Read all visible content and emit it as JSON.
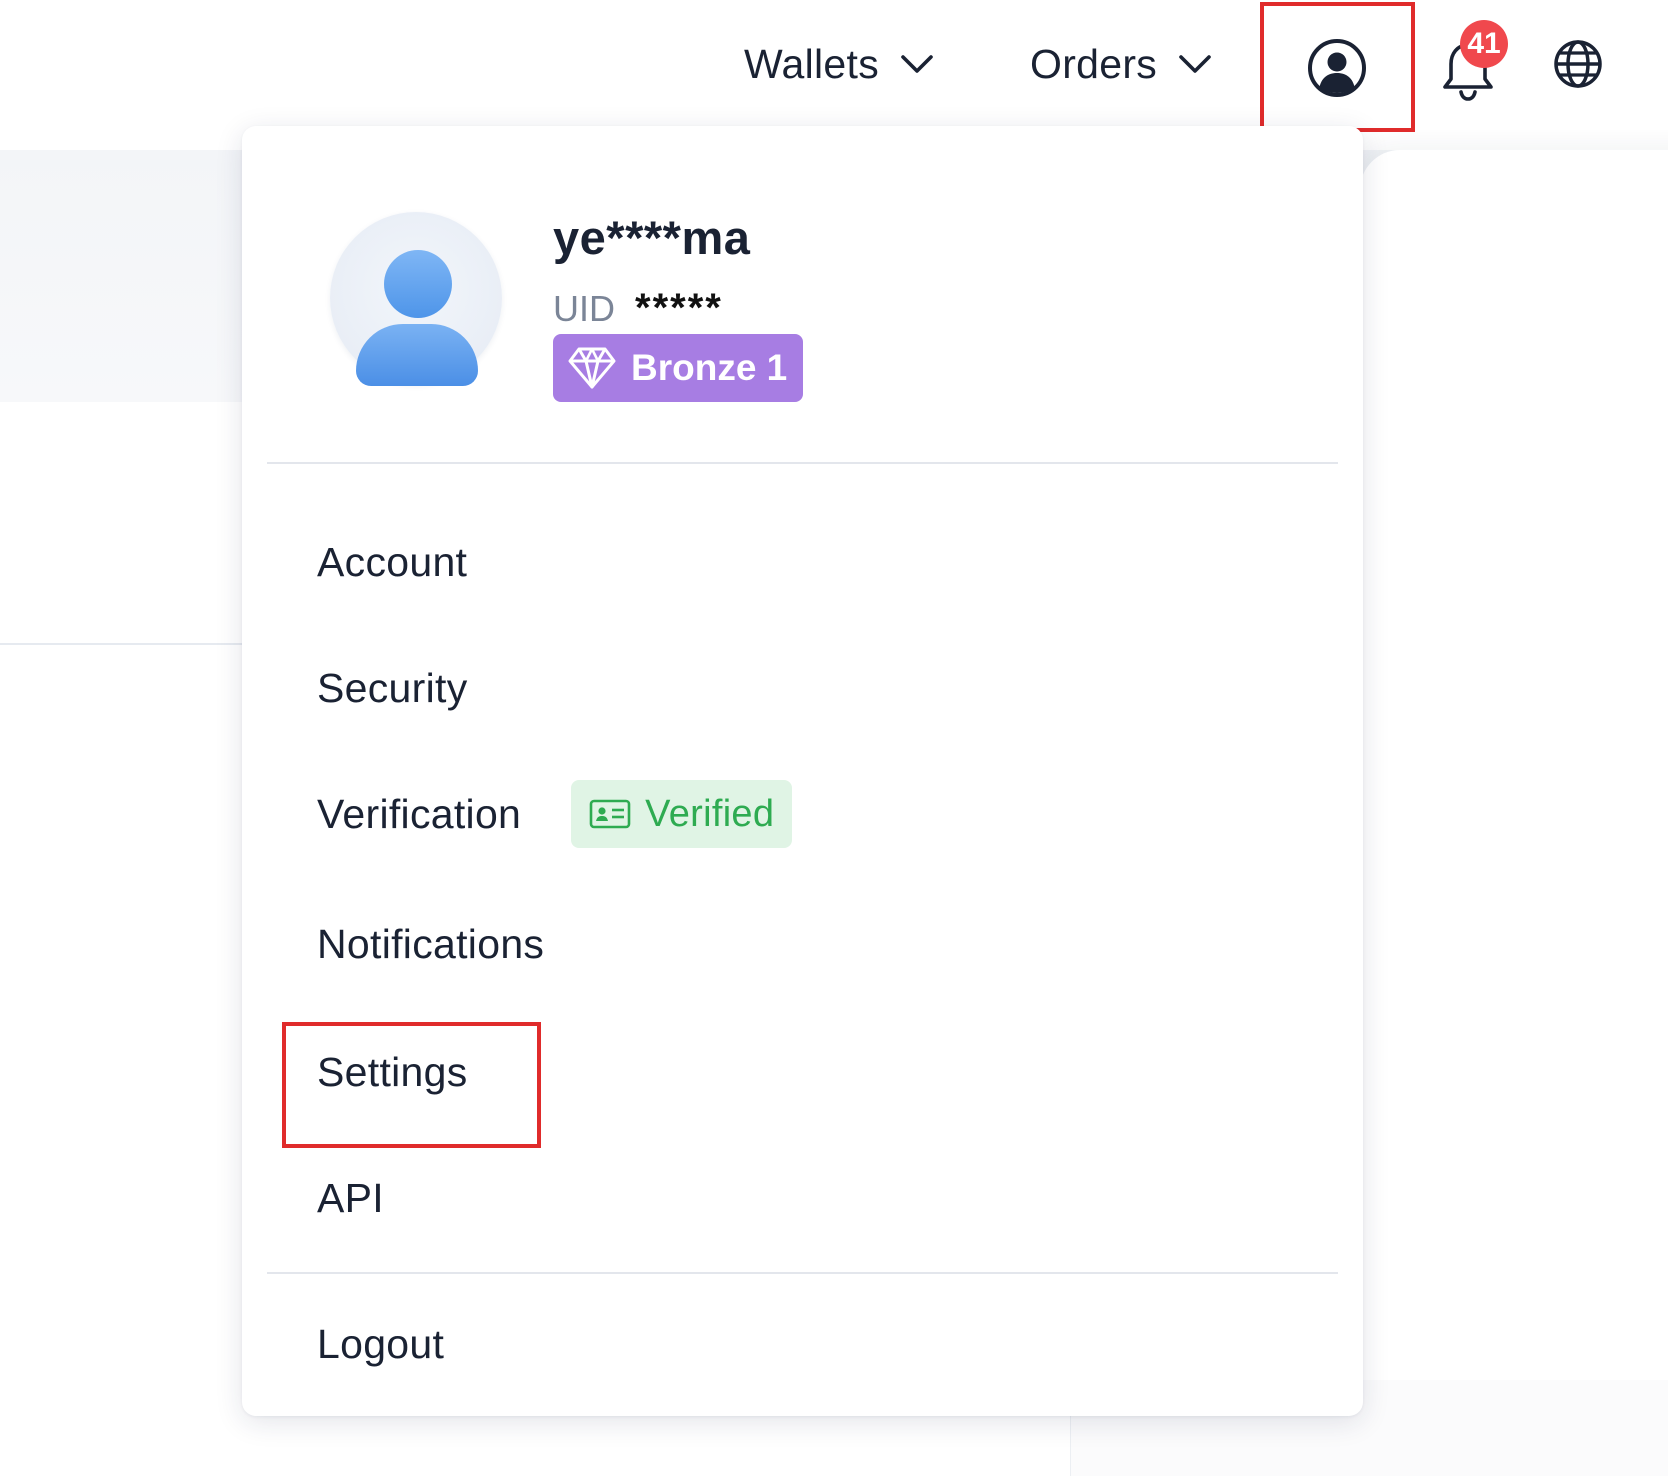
{
  "header": {
    "nav": [
      {
        "label": "Wallets"
      },
      {
        "label": "Orders"
      }
    ],
    "notifications_count": "41",
    "icons": {
      "user": "user-circle-icon",
      "bell": "bell-icon",
      "globe": "globe-icon"
    }
  },
  "profile": {
    "username": "ye****ma",
    "uid_label": "UID",
    "uid_value": "*****",
    "tier": "Bronze 1",
    "tier_color": "#a77de3"
  },
  "menu": {
    "account": "Account",
    "security": "Security",
    "verification": "Verification",
    "verification_status": "Verified",
    "notifications": "Notifications",
    "settings": "Settings",
    "api": "API",
    "logout": "Logout"
  },
  "colors": {
    "highlight": "#e02b2b",
    "verified_bg": "#e0f4e5",
    "verified_text": "#2eab51",
    "badge": "#f0484d"
  }
}
